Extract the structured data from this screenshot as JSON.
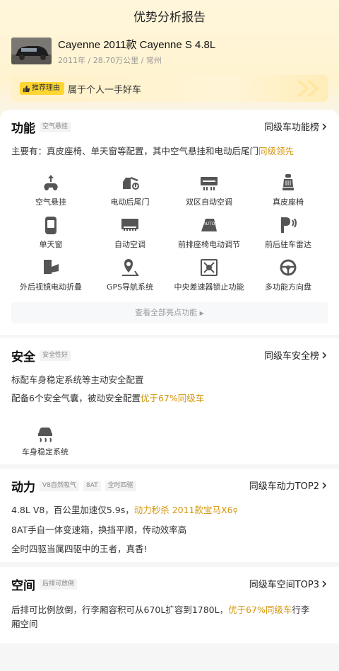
{
  "page": {
    "title": "优势分析报告"
  },
  "car": {
    "name": "Cayenne 2011款 Cayenne S 4.8L",
    "meta": "2011年 / 28.70万公里 / 常州"
  },
  "reason": {
    "tag": "推荐理由",
    "text": "属于个人一手好车"
  },
  "function": {
    "title": "功能",
    "chip": "空气悬挂",
    "rank": "同级车功能榜",
    "summary_prefix": "主要有：真皮座椅、单天窗等配置，其中空气悬挂和电动后尾门",
    "summary_highlight": "同级领先",
    "features": [
      {
        "label": "空气悬挂",
        "icon": "air-suspension-icon"
      },
      {
        "label": "电动后尾门",
        "icon": "power-tailgate-icon"
      },
      {
        "label": "双区自动空调",
        "icon": "dual-zone-ac-icon"
      },
      {
        "label": "真皮座椅",
        "icon": "leather-seat-icon"
      },
      {
        "label": "单天窗",
        "icon": "sunroof-icon"
      },
      {
        "label": "自动空调",
        "icon": "auto-ac-icon"
      },
      {
        "label": "前排座椅电动调节",
        "icon": "power-seat-icon"
      },
      {
        "label": "前后驻车雷达",
        "icon": "parking-radar-icon"
      },
      {
        "label": "外后视镜电动折叠",
        "icon": "mirror-fold-icon"
      },
      {
        "label": "GPS导航系统",
        "icon": "gps-icon"
      },
      {
        "label": "中央差速器锁止功能",
        "icon": "diff-lock-icon"
      },
      {
        "label": "多功能方向盘",
        "icon": "steering-wheel-icon"
      }
    ],
    "see_all": "查看全部亮点功能"
  },
  "safety": {
    "title": "安全",
    "chip": "安全性好",
    "rank": "同级车安全榜",
    "line1": "标配车身稳定系统等主动安全配置",
    "line2_prefix": "配备6个安全气囊，被动安全配置",
    "line2_highlight": "优于67%同级车",
    "features": [
      {
        "label": "车身稳定系统",
        "icon": "stability-control-icon"
      }
    ]
  },
  "power": {
    "title": "动力",
    "chips": [
      "V8自然吸气",
      "8AT",
      "全时四驱"
    ],
    "rank": "同级车动力TOP2",
    "line1_prefix": "4.8L V8，百公里加速仅5.9s，",
    "line1_highlight": "动力秒杀 2011款宝马X6",
    "line2": "8AT手自一体变速箱，换挡平顺，传动效率高",
    "line3": "全时四驱当属四驱中的王者，真香!"
  },
  "space": {
    "title": "空间",
    "chip": "后排可放倒",
    "rank": "同级车空间TOP3",
    "line1_prefix": "后排可比例放倒，行李厢容积可从670L扩容到1780L，",
    "line1_highlight": "优于67%同级车",
    "line1_suffix": "行李",
    "line2": "厢空间"
  },
  "colors": {
    "accent": "#d4950a",
    "tag_yellow": "#ffd531"
  }
}
